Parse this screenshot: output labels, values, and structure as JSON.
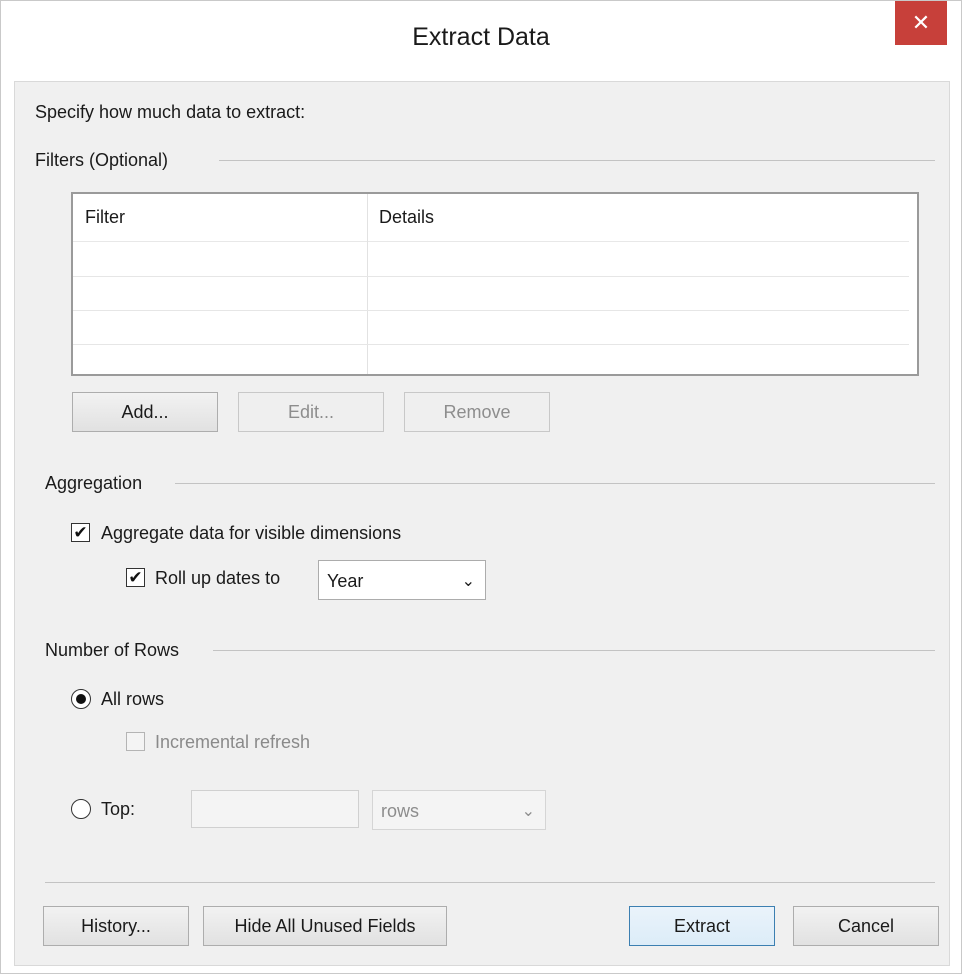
{
  "window": {
    "title": "Extract Data",
    "close_glyph": "✕"
  },
  "instruction": "Specify how much data to extract:",
  "filters": {
    "group_label": "Filters (Optional)",
    "columns": [
      "Filter",
      "Details"
    ],
    "rows": [],
    "add_label": "Add...",
    "edit_label": "Edit...",
    "remove_label": "Remove"
  },
  "aggregation": {
    "group_label": "Aggregation",
    "aggregate_label": "Aggregate data for visible dimensions",
    "aggregate_checked": true,
    "rollup_label": "Roll up dates to",
    "rollup_checked": true,
    "rollup_value": "Year"
  },
  "rows_section": {
    "group_label": "Number of Rows",
    "all_rows_label": "All rows",
    "all_rows_selected": true,
    "incremental_label": "Incremental refresh",
    "top_label": "Top:",
    "top_value": "",
    "top_unit": "rows"
  },
  "footer": {
    "history_label": "History...",
    "hide_unused_label": "Hide All Unused Fields",
    "extract_label": "Extract",
    "cancel_label": "Cancel"
  },
  "icons": {
    "check": "✔",
    "chevron": "⌄"
  },
  "colors": {
    "close_button": "#c7403a",
    "default_button_border": "#3c7fb1"
  }
}
